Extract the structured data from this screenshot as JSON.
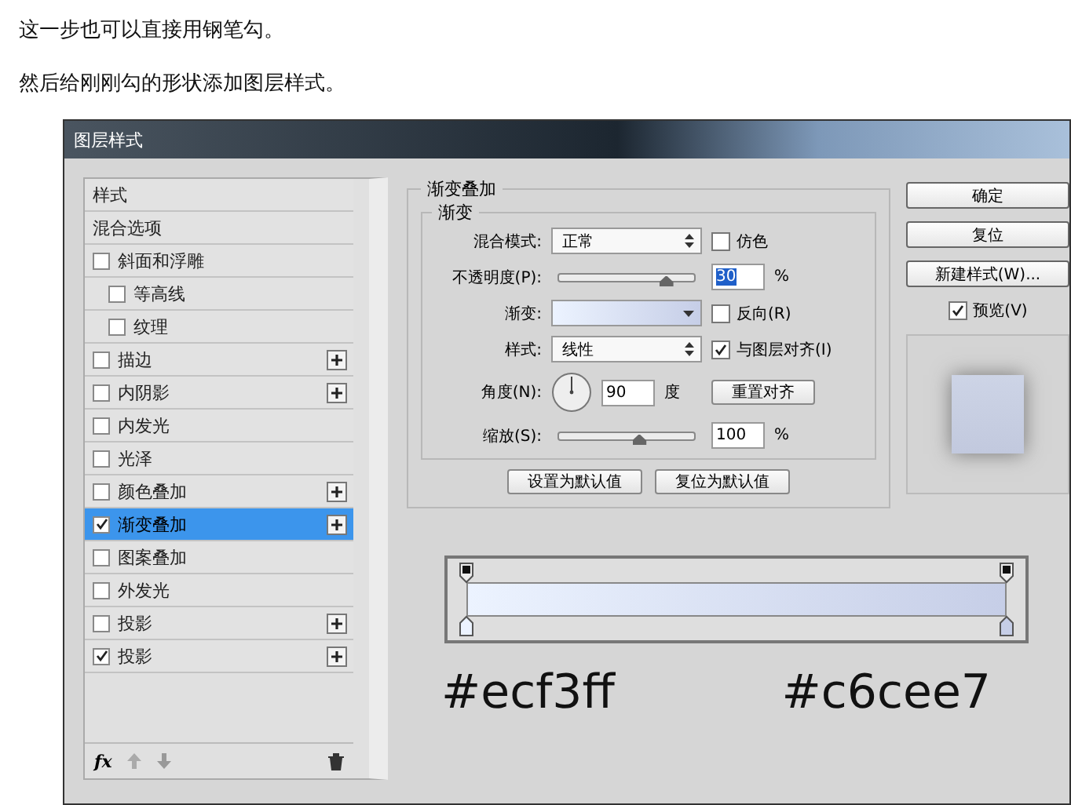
{
  "intro": [
    "这一步也可以直接用钢笔勾。",
    "然后给刚刚勾的形状添加图层样式。"
  ],
  "dialog": {
    "title": "图层样式",
    "styles": [
      {
        "label": "样式",
        "kind": "header",
        "selected": false
      },
      {
        "label": "混合选项",
        "kind": "header",
        "selected": false
      },
      {
        "label": "斜面和浮雕",
        "kind": "checkbox",
        "checked": false,
        "selected": false,
        "add": false,
        "children": [
          {
            "label": "等高线",
            "kind": "checkbox",
            "checked": false,
            "selected": false,
            "add": false
          },
          {
            "label": "纹理",
            "kind": "checkbox",
            "checked": false,
            "selected": false,
            "add": false
          }
        ]
      },
      {
        "label": "描边",
        "kind": "checkbox",
        "checked": false,
        "selected": false,
        "add": true
      },
      {
        "label": "内阴影",
        "kind": "checkbox",
        "checked": false,
        "selected": false,
        "add": true
      },
      {
        "label": "内发光",
        "kind": "checkbox",
        "checked": false,
        "selected": false,
        "add": false
      },
      {
        "label": "光泽",
        "kind": "checkbox",
        "checked": false,
        "selected": false,
        "add": false
      },
      {
        "label": "颜色叠加",
        "kind": "checkbox",
        "checked": false,
        "selected": false,
        "add": true
      },
      {
        "label": "渐变叠加",
        "kind": "checkbox",
        "checked": true,
        "selected": true,
        "add": true
      },
      {
        "label": "图案叠加",
        "kind": "checkbox",
        "checked": false,
        "selected": false,
        "add": false
      },
      {
        "label": "外发光",
        "kind": "checkbox",
        "checked": false,
        "selected": false,
        "add": false
      },
      {
        "label": "投影",
        "kind": "checkbox",
        "checked": false,
        "selected": false,
        "add": true
      },
      {
        "label": "投影",
        "kind": "checkbox",
        "checked": true,
        "selected": false,
        "add": true
      }
    ],
    "footer_fx": "fx",
    "panel": {
      "title": "渐变叠加",
      "group": "渐变",
      "blend_mode": {
        "label": "混合模式:",
        "value": "正常"
      },
      "dither": {
        "label": "仿色",
        "checked": false
      },
      "opacity": {
        "label": "不透明度(P):",
        "level": 0.8,
        "value": "30",
        "unit": "%"
      },
      "gradient": {
        "label": "渐变:"
      },
      "reverse": {
        "label": "反向(R)",
        "checked": false
      },
      "style": {
        "label": "样式:",
        "value": "线性"
      },
      "align": {
        "label": "与图层对齐(I)",
        "checked": true
      },
      "angle": {
        "label": "角度(N):",
        "value": "90",
        "unit": "度"
      },
      "reset_align": "重置对齐",
      "scale": {
        "label": "缩放(S):",
        "level": 0.6,
        "value": "100",
        "unit": "%"
      },
      "buttons": [
        "设置为默认值",
        "复位为默认值"
      ]
    },
    "side_buttons": [
      "确定",
      "复位",
      "新建样式(W)..."
    ],
    "preview": {
      "label": "预览(V)",
      "checked": true
    }
  },
  "gradient_editor": {
    "stops": [
      {
        "color": "#ecf3ff",
        "label": "#ecf3ff"
      },
      {
        "color": "#c6cee7",
        "label": "#c6cee7"
      }
    ]
  }
}
